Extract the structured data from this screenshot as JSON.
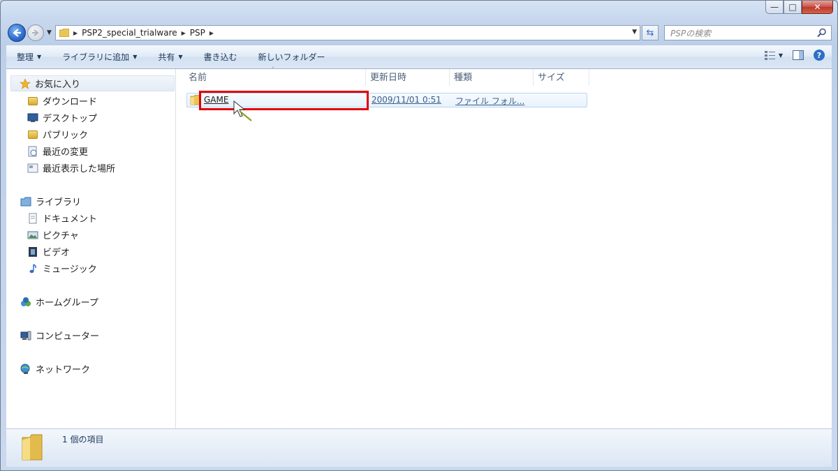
{
  "window": {
    "caption_buttons": {
      "minimize": "—",
      "maximize": "□",
      "close": "✕"
    }
  },
  "address": {
    "crumbs": [
      "PSP2_special_trialware",
      "PSP"
    ],
    "search_placeholder": "PSPの検索"
  },
  "toolbar": {
    "items": [
      {
        "label": "整理",
        "dropdown": true
      },
      {
        "label": "ライブラリに追加",
        "dropdown": true
      },
      {
        "label": "共有",
        "dropdown": true
      },
      {
        "label": "書き込む",
        "dropdown": false
      },
      {
        "label": "新しいフォルダー",
        "dropdown": false
      }
    ],
    "help_label": "?"
  },
  "sidebar": {
    "favorites": {
      "label": "お気に入り",
      "icon": "star-icon"
    },
    "favorite_items": [
      {
        "label": "ダウンロード",
        "icon": "download-folder-icon"
      },
      {
        "label": "デスクトップ",
        "icon": "desktop-icon"
      },
      {
        "label": "パブリック",
        "icon": "folder-icon"
      },
      {
        "label": "最近の変更",
        "icon": "recent-changes-icon"
      },
      {
        "label": "最近表示した場所",
        "icon": "recent-places-icon"
      }
    ],
    "libraries": {
      "label": "ライブラリ",
      "icon": "library-icon"
    },
    "library_items": [
      {
        "label": "ドキュメント",
        "icon": "document-icon"
      },
      {
        "label": "ピクチャ",
        "icon": "picture-icon"
      },
      {
        "label": "ビデオ",
        "icon": "video-icon"
      },
      {
        "label": "ミュージック",
        "icon": "music-icon"
      }
    ],
    "homegroup": {
      "label": "ホームグループ",
      "icon": "homegroup-icon"
    },
    "computer": {
      "label": "コンピューター",
      "icon": "computer-icon"
    },
    "network": {
      "label": "ネットワーク",
      "icon": "network-icon"
    }
  },
  "columns": {
    "name": "名前",
    "modified": "更新日時",
    "type": "種類",
    "size": "サイズ"
  },
  "files": [
    {
      "name": "GAME",
      "modified": "2009/11/01 0:51",
      "type": "ファイル フォル...",
      "size": ""
    }
  ],
  "status": {
    "text": "1 個の項目"
  },
  "colors": {
    "highlight": "#e00000",
    "accent": "#2d6ccf"
  }
}
